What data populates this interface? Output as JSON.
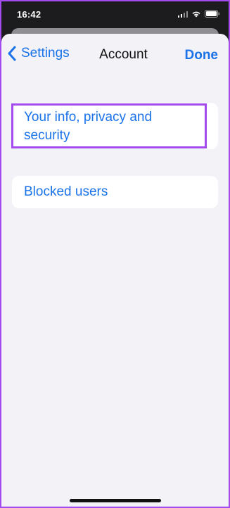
{
  "status_bar": {
    "time": "16:42"
  },
  "icons": {
    "signal": "signal-icon",
    "wifi": "wifi-icon",
    "battery": "battery-icon",
    "back": "chevron-left-icon"
  },
  "nav": {
    "back_label": "Settings",
    "title": "Account",
    "done_label": "Done"
  },
  "items": [
    {
      "label": "Your info, privacy and security",
      "highlighted": true
    },
    {
      "label": "Blocked users",
      "highlighted": false
    }
  ],
  "colors": {
    "accent": "#1a73e8",
    "highlight": "#a24cf0",
    "background": "#f2f2f7",
    "card": "#ffffff"
  }
}
